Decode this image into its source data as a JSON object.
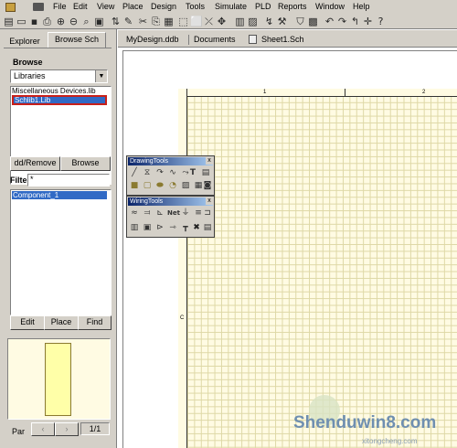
{
  "menu": [
    "File",
    "Edit",
    "View",
    "Place",
    "Design",
    "Tools",
    "Simulate",
    "PLD",
    "Reports",
    "Window",
    "Help"
  ],
  "panel": {
    "tabs": [
      "Explorer",
      "Browse Sch"
    ],
    "browse_label": "Browse",
    "browse_select": "Libraries",
    "libraries": [
      "Miscellaneous Devices.lib",
      "Schlib1.Lib"
    ],
    "add_remove": "dd/Remove",
    "browse_button": "Browse",
    "filter_label": "Filte",
    "filter_value": "*",
    "components": [
      "Component_1"
    ],
    "edit_button": "Edit",
    "place_button": "Place",
    "find_button": "Find",
    "part_label": "Par",
    "part_counter": "1/1"
  },
  "doc_tabs": [
    "MyDesign.ddb",
    "Documents",
    "Sheet1.Sch"
  ],
  "sheet": {
    "zone_labels": [
      "1",
      "2",
      "C"
    ]
  },
  "palettes": {
    "drawing": {
      "title": "DrawingTools",
      "close": "x"
    },
    "wiring": {
      "title": "WiringTools",
      "close": "x"
    }
  },
  "watermark": {
    "main": "Shenduwin8.com",
    "sub": "xitongcheng.com"
  },
  "colors": {
    "selection": "#316ac5",
    "grid_bg": "#fffbe3",
    "highlight_border": "#c8201a"
  }
}
